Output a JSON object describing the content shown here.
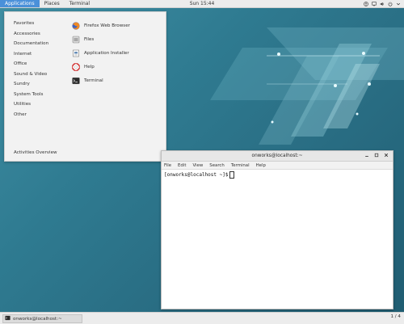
{
  "topbar": {
    "applications": "Applications",
    "places": "Places",
    "terminal": "Terminal",
    "clock": "Sun 15:44",
    "tray_icons": [
      "accessibility-icon",
      "network-icon",
      "volume-icon",
      "power-icon",
      "chevron-down-icon"
    ]
  },
  "menu": {
    "categories": [
      "Favorites",
      "Accessories",
      "Documentation",
      "Internet",
      "Office",
      "Sound & Video",
      "Sundry",
      "System Tools",
      "Utilities",
      "Other"
    ],
    "apps": [
      {
        "label": "Firefox Web Browser",
        "icon": "firefox-icon"
      },
      {
        "label": "Files",
        "icon": "files-icon"
      },
      {
        "label": "Application Installer",
        "icon": "installer-icon"
      },
      {
        "label": "Help",
        "icon": "help-icon"
      },
      {
        "label": "Terminal",
        "icon": "terminal-icon"
      }
    ],
    "overview": "Activities Overview"
  },
  "terminal": {
    "title": "onworks@localhost:~",
    "menus": [
      "File",
      "Edit",
      "View",
      "Search",
      "Terminal",
      "Help"
    ],
    "prompt": "[onworks@localhost ~]$"
  },
  "taskbar": {
    "task_label": "onworks@localhost:~",
    "workspace": "1 / 4"
  },
  "colors": {
    "accent": "#4a90d9",
    "desktop": "#2a6f85"
  }
}
